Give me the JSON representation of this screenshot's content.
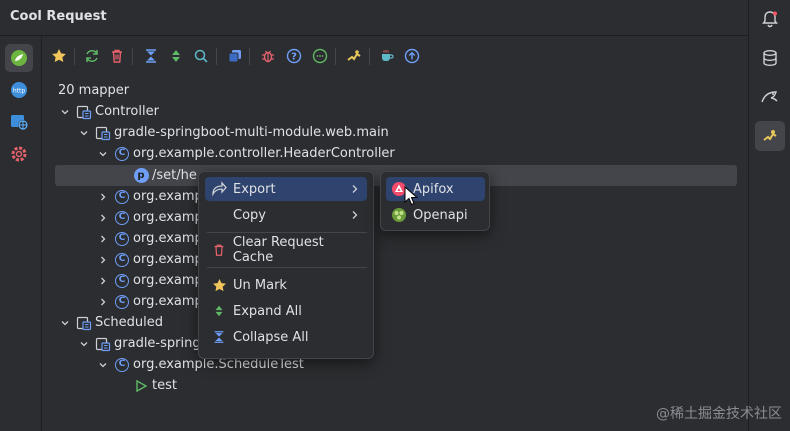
{
  "window": {
    "title": "Cool Request"
  },
  "right_strip": {
    "icons": [
      "bell-icon",
      "database-icon",
      "mongo-icon",
      "cool-request-icon"
    ]
  },
  "left_strip": {
    "icons": [
      "spring-icon",
      "http-icon",
      "web-icon",
      "settings-icon"
    ]
  },
  "toolbar": {
    "icons": [
      "star-icon",
      "refresh-icon",
      "delete-icon",
      "collapse-all-icon",
      "expand-all-icon",
      "search-icon",
      "copy-icon",
      "bug-icon",
      "help-icon",
      "chat-icon",
      "plugin-icon",
      "coffee-icon",
      "upload-icon"
    ]
  },
  "tree": {
    "header": "20 mapper",
    "controller_label": "Controller",
    "module_main": "gradle-springboot-multi-module.web.main",
    "header_controller": "org.example.controller.HeaderController",
    "selected_path": "/set/he",
    "org_rows": [
      "org.examp",
      "org.examp",
      "org.examp",
      "org.examp",
      "org.examp",
      "org.examp"
    ],
    "scheduled_label": "Scheduled",
    "module_scheduled": "gradle-spring",
    "schedule_test": "org.example.ScheduleTest",
    "test_label": "test"
  },
  "context_menu": {
    "export": "Export",
    "copy": "Copy",
    "clear_cache": "Clear Request Cache",
    "unmark": "Un Mark",
    "expand_all": "Expand All",
    "collapse_all": "Collapse All"
  },
  "submenu": {
    "apifox": "Apifox",
    "openapi": "Openapi"
  },
  "watermark": "@稀土掘金技术社区",
  "colors": {
    "accent": "#2e436e",
    "class_icon": "#6f9ef8",
    "selection": "#43454a"
  }
}
